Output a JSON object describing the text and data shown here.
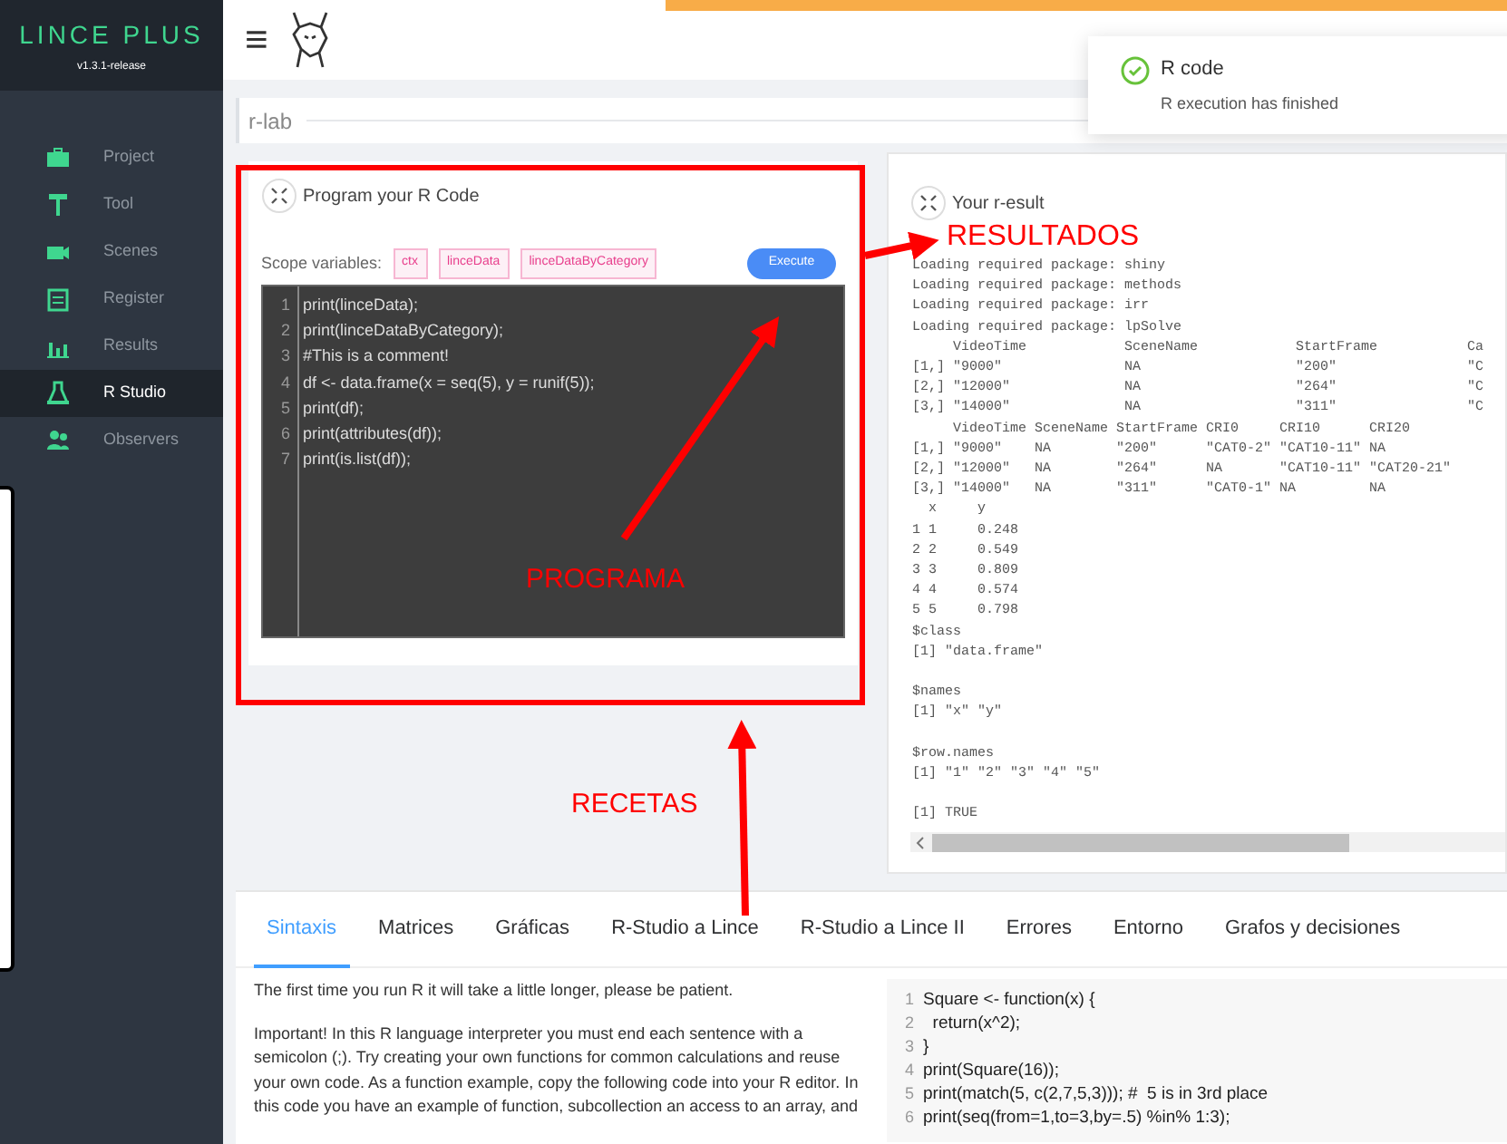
{
  "sidebar": {
    "brand": "LINCE PLUS",
    "version": "v1.3.1-release",
    "items": [
      {
        "label": "Project",
        "selected": false
      },
      {
        "label": "Tool",
        "selected": false
      },
      {
        "label": "Scenes",
        "selected": false
      },
      {
        "label": "Register",
        "selected": false
      },
      {
        "label": "Results",
        "selected": false
      },
      {
        "label": "R Studio",
        "selected": true
      },
      {
        "label": "Observers",
        "selected": false
      }
    ]
  },
  "header": {
    "menu_icon": "≡"
  },
  "breadcrumb": "r-lab",
  "program_card": {
    "title": "Program your R Code",
    "scope_label": "Scope variables:",
    "scope_variables": [
      "ctx",
      "linceData",
      "linceDataByCategory"
    ],
    "execute_button": "Execute",
    "code": [
      {
        "line": "1",
        "text": "print(linceData);"
      },
      {
        "line": "2",
        "text": "print(linceDataByCategory);"
      },
      {
        "line": "3",
        "text": "#This is a comment!"
      },
      {
        "line": "4",
        "text": "df <- data.frame(x = seq(5), y = runif(5));"
      },
      {
        "line": "5",
        "text": "print(df);"
      },
      {
        "line": "6",
        "text": "print(attributes(df));"
      },
      {
        "line": "7",
        "text": "print(is.list(df));"
      }
    ]
  },
  "result_card": {
    "title": "Your r-esult",
    "output_blocks": [
      [
        "Loading required package: shiny",
        "Loading required package: methods",
        "Loading required package: irr",
        "Loading required package: lpSolve",
        "     VideoTime            SceneName            StartFrame           Ca",
        "[1,] \"9000\"               NA                   \"200\"                \"C",
        "[2,] \"12000\"              NA                   \"264\"                \"C",
        "[3,] \"14000\"              NA                   \"311\"                \"C",
        "     VideoTime SceneName StartFrame CRI0     CRI10      CRI20",
        "[1,] \"9000\"    NA        \"200\"      \"CAT0-2\" \"CAT10-11\" NA",
        "[2,] \"12000\"   NA        \"264\"      NA       \"CAT10-11\" \"CAT20-21\"",
        "[3,] \"14000\"   NA        \"311\"      \"CAT0-1\" NA         NA",
        "  x     y",
        "1 1     0.248",
        "2 2     0.549",
        "3 3     0.809",
        "4 4     0.574",
        "5 5     0.798",
        "$class",
        "[1] \"data.frame\""
      ],
      [
        "$names",
        "[1] \"x\" \"y\""
      ],
      [
        "$row.names",
        "[1] \"1\" \"2\" \"3\" \"4\" \"5\""
      ],
      [
        "[1] TRUE"
      ]
    ]
  },
  "recipes": {
    "tabs": [
      {
        "label": "Sintaxis",
        "selected": true
      },
      {
        "label": "Matrices",
        "selected": false
      },
      {
        "label": "Gráficas",
        "selected": false
      },
      {
        "label": "R-Studio a Lince",
        "selected": false
      },
      {
        "label": "R-Studio a Lince II",
        "selected": false
      },
      {
        "label": "Errores",
        "selected": false
      },
      {
        "label": "Entorno",
        "selected": false
      },
      {
        "label": "Grafos y decisiones",
        "selected": false
      }
    ],
    "paragraphs": [
      "The first time you run R it will take a little longer, please be patient.",
      "Important! In this R language interpreter you must end each sentence with a semicolon (;). Try creating your own functions for common calculations and reuse your own code. As a function example, copy the following code into your R editor. In this code you have an example of function, subcollection an access to an array, and"
    ],
    "code": [
      {
        "line": "1",
        "text": "Square <- function(x) {"
      },
      {
        "line": "2",
        "text": "  return(x^2);"
      },
      {
        "line": "3",
        "text": "}"
      },
      {
        "line": "4",
        "text": "print(Square(16));"
      },
      {
        "line": "5",
        "text": "print(match(5, c(2,7,5,3))); #  5 is in 3rd place"
      },
      {
        "line": "6",
        "text": "print(seq(from=1,to=3,by=.5) %in% 1:3);"
      }
    ]
  },
  "toast": {
    "title": "R code",
    "message": "R execution has finished"
  },
  "annotations": [
    {
      "text": "RESULTADOS"
    },
    {
      "text": "PROGRAMA"
    },
    {
      "text": "RECETAS"
    }
  ]
}
